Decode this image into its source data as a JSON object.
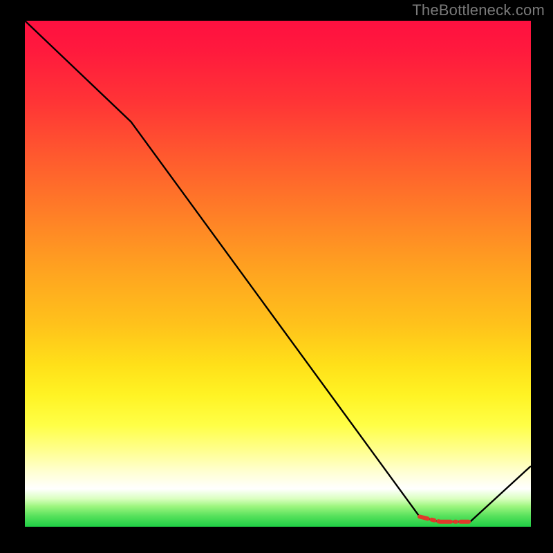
{
  "attribution": "TheBottleneck.com",
  "colors": {
    "curve": "#000000",
    "highlight": "#e03a2a",
    "gradient_top": "#ff1040",
    "gradient_bottom": "#1fcf46",
    "frame": "#000000"
  },
  "chart_data": {
    "type": "line",
    "title": "",
    "xlabel": "",
    "ylabel": "",
    "xlim": [
      0,
      100
    ],
    "ylim": [
      0,
      100
    ],
    "series": [
      {
        "name": "curve",
        "x": [
          0,
          21,
          78,
          82,
          88,
          100
        ],
        "values": [
          100,
          80,
          2,
          1,
          1,
          12
        ]
      },
      {
        "name": "highlight",
        "x": [
          78,
          82,
          88
        ],
        "values": [
          2,
          1,
          1
        ]
      }
    ]
  }
}
